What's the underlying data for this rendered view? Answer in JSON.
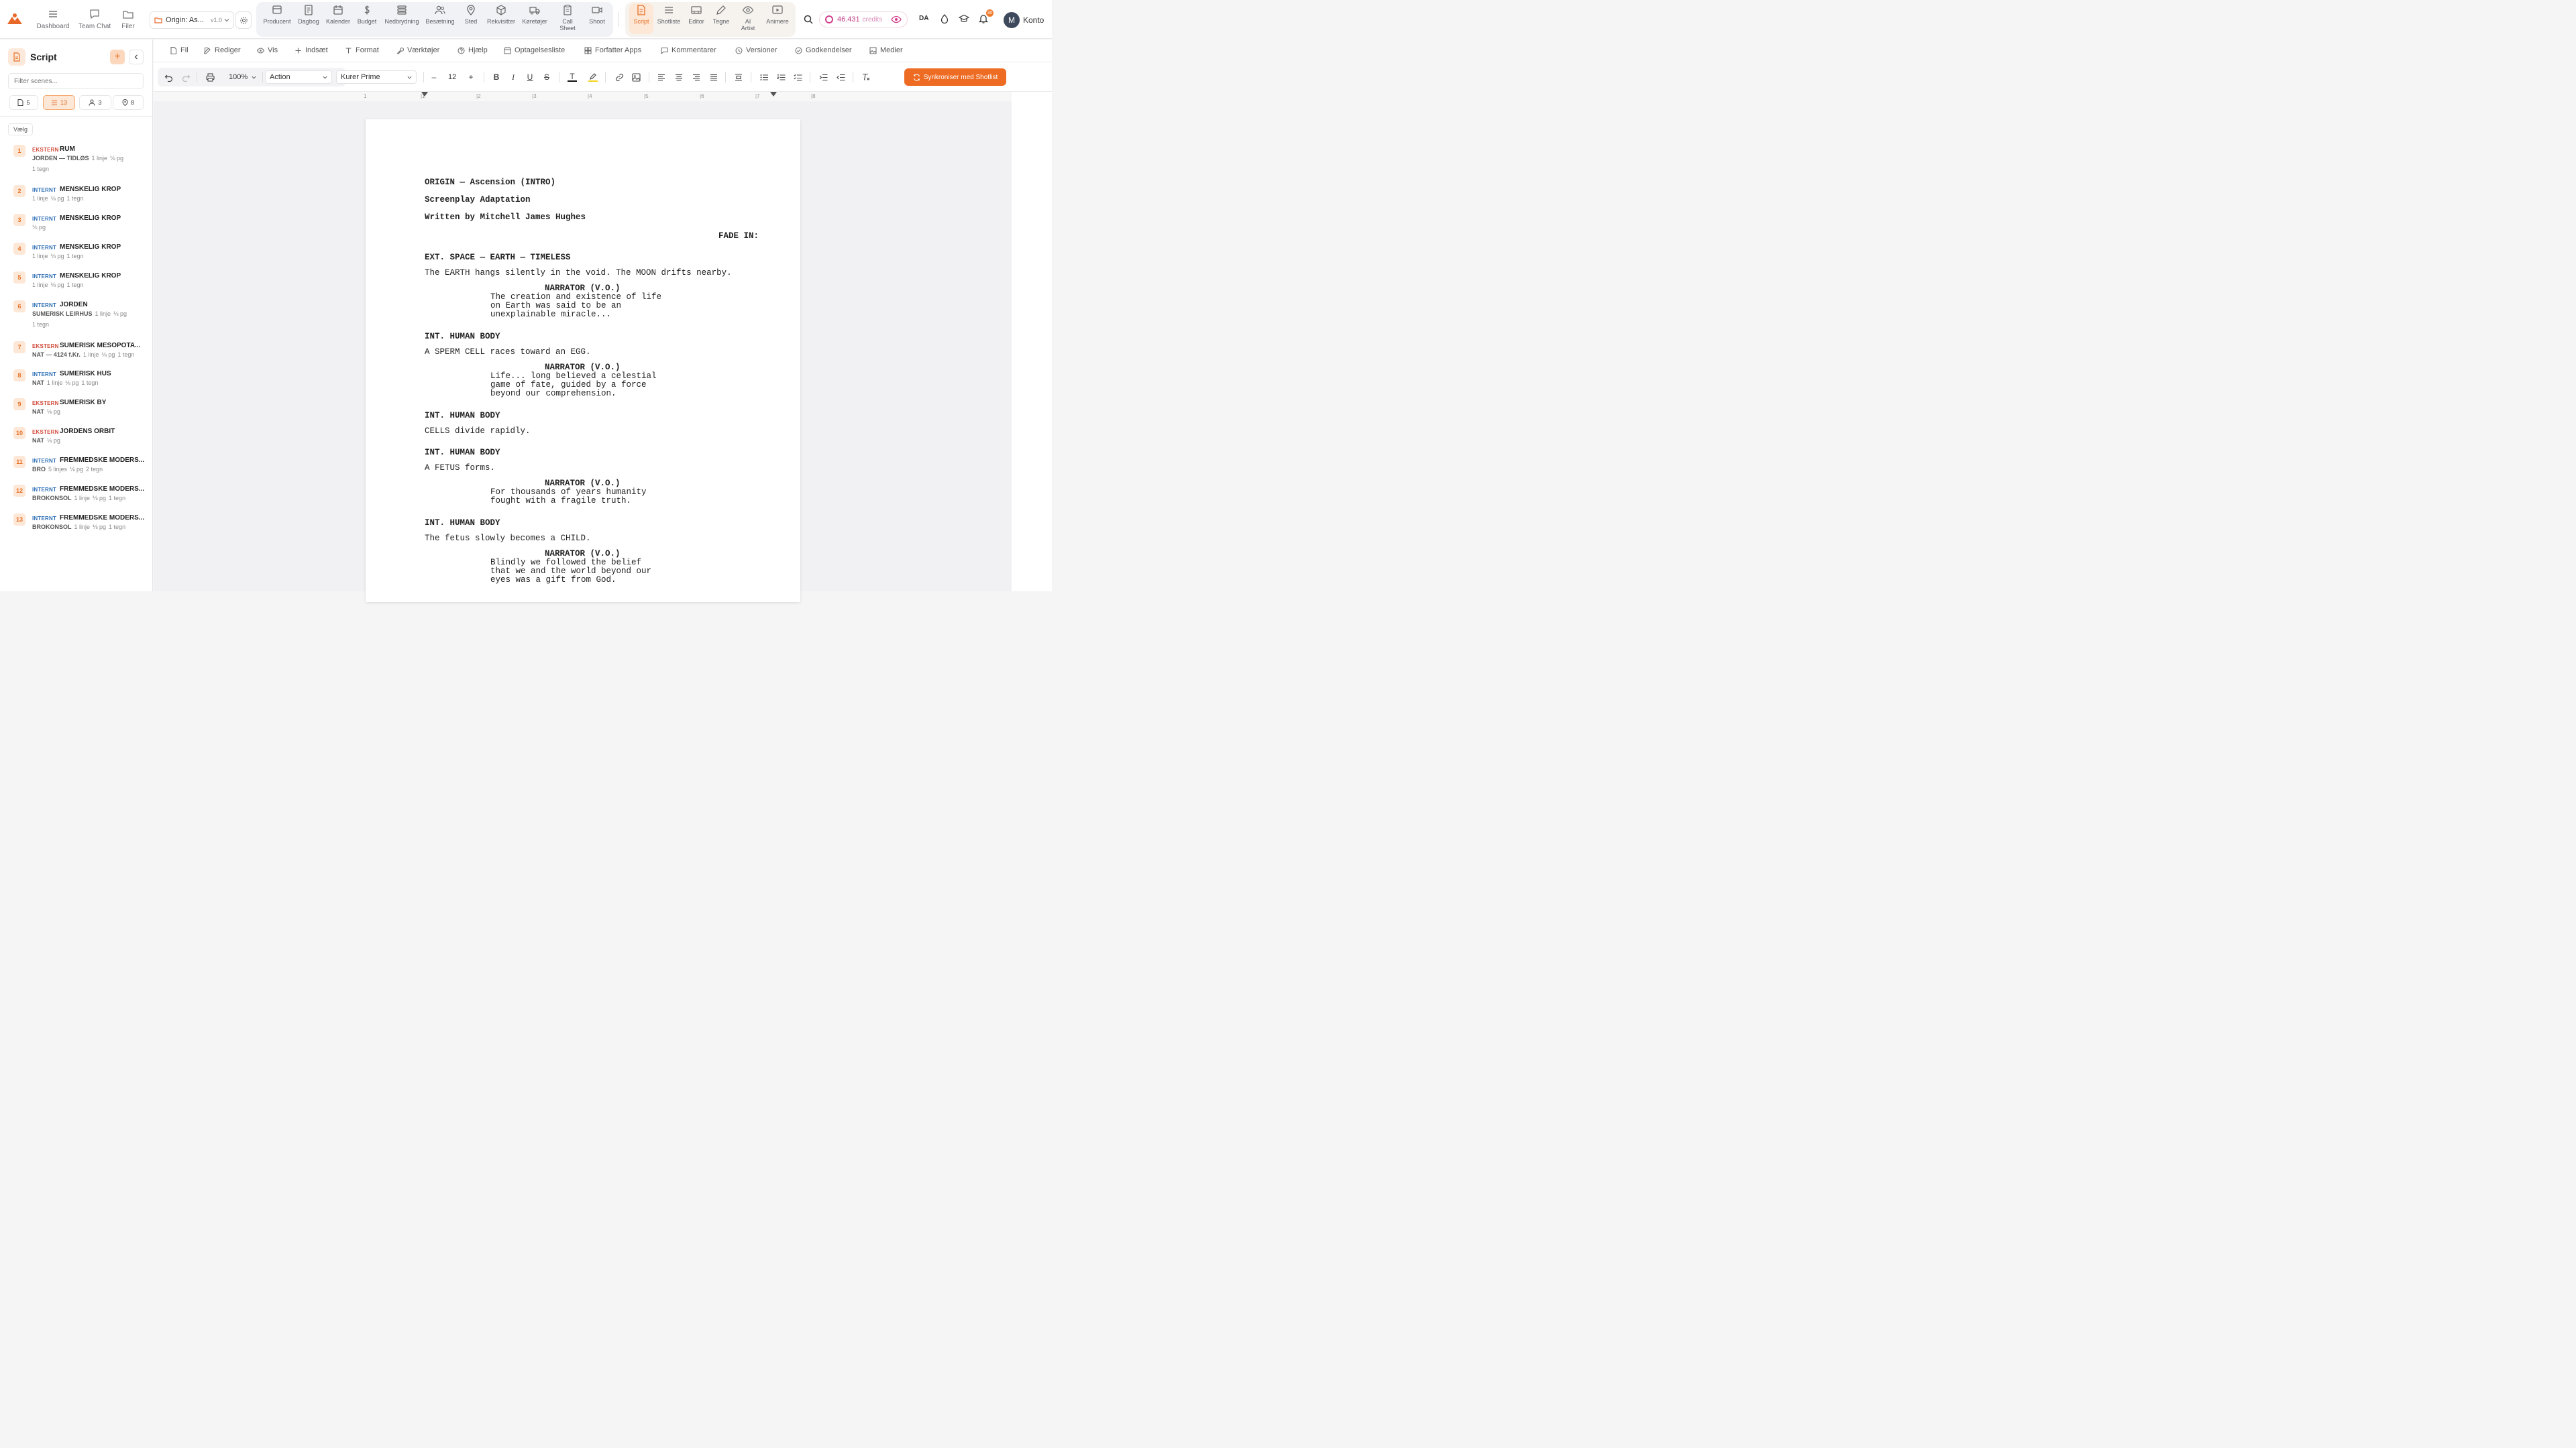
{
  "topbar": {
    "nav": [
      {
        "label": "Dashboard",
        "icon": "grid-menu-icon"
      },
      {
        "label": "Team Chat",
        "icon": "chat-icon"
      },
      {
        "label": "Filer",
        "icon": "folder-icon"
      }
    ],
    "project": {
      "name": "Origin: As...",
      "version": "v1.0"
    },
    "tools": [
      {
        "label": "Producent"
      },
      {
        "label": "Dagbog"
      },
      {
        "label": "Kalender"
      },
      {
        "label": "Budget"
      },
      {
        "label": "Nedbrydning"
      },
      {
        "label": "Besætning"
      },
      {
        "label": "Sted"
      },
      {
        "label": "Rekvisitter"
      },
      {
        "label": "Køretøjer"
      },
      {
        "label": "Call Sheet"
      },
      {
        "label": "Shoot"
      }
    ],
    "tools2": [
      {
        "label": "Script"
      },
      {
        "label": "Shotliste"
      },
      {
        "label": "Editor"
      },
      {
        "label": "Tegne"
      },
      {
        "label": "AI Artist"
      },
      {
        "label": "Animere"
      }
    ],
    "credits": {
      "value": "46.431",
      "unit": "credits"
    },
    "language": "DA",
    "notifications": "30",
    "avatar_initial": "M",
    "account_label": "Konto"
  },
  "sidebar": {
    "title": "Script",
    "filter_placeholder": "Filter scenes...",
    "tabs": [
      {
        "count": "5",
        "icon": "file-icon"
      },
      {
        "count": "13",
        "icon": "list-icon"
      },
      {
        "count": "3",
        "icon": "person-icon"
      },
      {
        "count": "8",
        "icon": "pin-icon"
      }
    ],
    "select_label": "Vælg",
    "scenes": [
      {
        "num": "1",
        "type": "EKSTERN",
        "name": "RUM",
        "loc": "JORDEN — TIDLØS",
        "lines": "1 linje",
        "pages": "⅛ pg",
        "chars": "1 tegn",
        "wrap": true
      },
      {
        "num": "2",
        "type": "INTERNT",
        "name": "MENSKELIG KROP",
        "loc": "",
        "lines": "1 linje",
        "pages": "⅛ pg",
        "chars": "1 tegn",
        "wrap": false
      },
      {
        "num": "3",
        "type": "INTERNT",
        "name": "MENSKELIG KROP",
        "loc": "",
        "lines": "",
        "pages": "⅛ pg",
        "chars": "",
        "wrap": false
      },
      {
        "num": "4",
        "type": "INTERNT",
        "name": "MENSKELIG KROP",
        "loc": "",
        "lines": "1 linje",
        "pages": "⅛ pg",
        "chars": "1 tegn",
        "wrap": false
      },
      {
        "num": "5",
        "type": "INTERNT",
        "name": "MENSKELIG KROP",
        "loc": "",
        "lines": "1 linje",
        "pages": "⅛ pg",
        "chars": "1 tegn",
        "wrap": false
      },
      {
        "num": "6",
        "type": "INTERNT",
        "name": "JORDEN",
        "loc": "SUMERISK LEIRHUS",
        "lines": "1 linje",
        "pages": "⅛ pg",
        "chars": "1 tegn",
        "wrap": true
      },
      {
        "num": "7",
        "type": "EKSTERN",
        "name": "SUMERISK MESOPOTA...",
        "loc": "NAT — 4124 f.Kr.",
        "lines": "1 linje",
        "pages": "⅛ pg",
        "chars": "1 tegn",
        "wrap": false
      },
      {
        "num": "8",
        "type": "INTERNT",
        "name": "SUMERISK HUS",
        "loc": "NAT",
        "lines": "1 linje",
        "pages": "⅛ pg",
        "chars": "1 tegn",
        "wrap": false
      },
      {
        "num": "9",
        "type": "EKSTERN",
        "name": "SUMERISK BY",
        "loc": "NAT",
        "lines": "",
        "pages": "⅛ pg",
        "chars": "",
        "wrap": false
      },
      {
        "num": "10",
        "type": "EKSTERN",
        "name": "JORDENS ORBIT",
        "loc": "NAT",
        "lines": "",
        "pages": "⅛ pg",
        "chars": "",
        "wrap": false
      },
      {
        "num": "11",
        "type": "INTERNT",
        "name": "FREMMEDSKE MODERS...",
        "loc": "BRO",
        "lines": "5 linjes",
        "pages": "⅛ pg",
        "chars": "2 tegn",
        "wrap": false
      },
      {
        "num": "12",
        "type": "INTERNT",
        "name": "FREMMEDSKE MODERS...",
        "loc": "BROKONSOL",
        "lines": "1 linje",
        "pages": "⅛ pg",
        "chars": "1 tegn",
        "wrap": false
      },
      {
        "num": "13",
        "type": "INTERNT",
        "name": "FREMMEDSKE MODERS...",
        "loc": "BROKONSOL",
        "lines": "1 linje",
        "pages": "⅛ pg",
        "chars": "1 tegn",
        "wrap": false
      }
    ]
  },
  "menubar": [
    {
      "label": "Fil",
      "icon": "file-icon"
    },
    {
      "label": "Rediger",
      "icon": "edit-icon"
    },
    {
      "label": "Vis",
      "icon": "eye-icon"
    },
    {
      "label": "Indsæt",
      "icon": "plus-icon"
    },
    {
      "label": "Format",
      "icon": "text-format-icon"
    },
    {
      "label": "Værktøjer",
      "icon": "wrench-icon"
    },
    {
      "label": "Hjælp",
      "icon": "help-icon"
    },
    {
      "label": "Optagelsesliste",
      "icon": "clapper-icon"
    },
    {
      "label": "Forfatter Apps",
      "icon": "apps-icon"
    },
    {
      "label": "Kommentarer",
      "icon": "comment-icon"
    },
    {
      "label": "Versioner",
      "icon": "clock-icon"
    },
    {
      "label": "Godkendelser",
      "icon": "check-circle-icon"
    },
    {
      "label": "Medier",
      "icon": "image-icon"
    }
  ],
  "formatbar": {
    "zoom": "100%",
    "element_type": "Action",
    "font": "Kurer Prime",
    "font_size": "12",
    "sync_label": "Synkroniser med Shotlist",
    "ruler": [
      "1",
      "|1",
      "|2",
      "|3",
      "|4",
      "|5",
      "|6",
      "|7",
      "|8"
    ]
  },
  "script": {
    "title": "ORIGIN — Ascension (INTRO)",
    "subtitle": "Screenplay Adaptation",
    "author": "Written by Mitchell James Hughes",
    "transition": "FADE IN:",
    "scene1_heading": "EXT. SPACE — EARTH — TIMELESS",
    "scene1_action": "The EARTH hangs silently in the void. The MOON drifts nearby.",
    "narrator": "NARRATOR (V.O.)",
    "scene1_dialogue": "The creation and existence of life\non Earth was said to be an\nunexplainable miracle...",
    "scene2_heading": "INT. HUMAN BODY",
    "scene2_action": "A SPERM CELL races toward an EGG.",
    "scene2_dialogue": "Life... long believed a celestial\ngame of fate, guided by a force\nbeyond our comprehension.",
    "scene3_heading": "INT. HUMAN BODY",
    "scene3_action": "CELLS divide rapidly.",
    "scene4_heading": "INT. HUMAN BODY",
    "scene4_action": "A FETUS forms.",
    "scene4_dialogue": "For thousands of years humanity\nfought with a fragile truth.",
    "scene5_heading": "INT. HUMAN BODY",
    "scene5_action": "The fetus slowly becomes a CHILD.",
    "scene5_dialogue": "Blindly we followed the belief\nthat we and the world beyond our\neyes was a gift from God."
  },
  "colors": {
    "accent": "#ed6b22",
    "ext": "#d24a3a",
    "int": "#2f6fb5",
    "credits": "#d43f8d"
  }
}
